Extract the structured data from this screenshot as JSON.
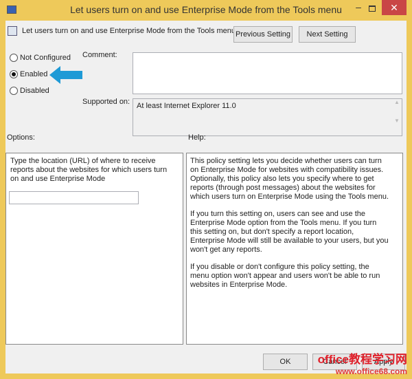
{
  "window": {
    "title": "Let users turn on and use Enterprise Mode from the Tools menu",
    "minimize": "–",
    "close": "✕"
  },
  "header": {
    "setting_title": "Let users turn on and use Enterprise Mode from the Tools menu",
    "previous_button": "Previous Setting",
    "next_button": "Next Setting"
  },
  "state": {
    "options": [
      {
        "label": "Not Configured",
        "selected": false
      },
      {
        "label": "Enabled",
        "selected": true
      },
      {
        "label": "Disabled",
        "selected": false
      }
    ]
  },
  "comment": {
    "label": "Comment:",
    "value": ""
  },
  "supported": {
    "label": "Supported on:",
    "value": "At least Internet Explorer 11.0"
  },
  "options_panel": {
    "label": "Options:",
    "description": "Type the location (URL) of where to receive reports about the websites for which users turn on and use Enterprise Mode",
    "url_value": ""
  },
  "help_panel": {
    "label": "Help:",
    "paragraphs": [
      "This policy setting lets you decide whether users can turn on Enterprise Mode for websites with compatibility issues. Optionally, this policy also lets you specify where to get reports (through post messages) about the websites for which users turn on Enterprise Mode using the Tools menu.",
      "If you turn this setting on, users can see and use the Enterprise Mode option from the Tools menu. If you turn this setting on, but don't specify a report location, Enterprise Mode will still be available to your users, but you won't get any reports.",
      "If you disable or don't configure this policy setting, the menu option won't appear and users won't be able to run websites in Enterprise Mode."
    ]
  },
  "footer": {
    "ok": "OK",
    "cancel": "Cancel",
    "apply": "Apply"
  },
  "watermark": {
    "line1": "office教程学习网",
    "line2": "www.office68.com"
  },
  "colors": {
    "frame": "#eec95a",
    "close": "#c94646",
    "arrow": "#1e9ad6"
  }
}
